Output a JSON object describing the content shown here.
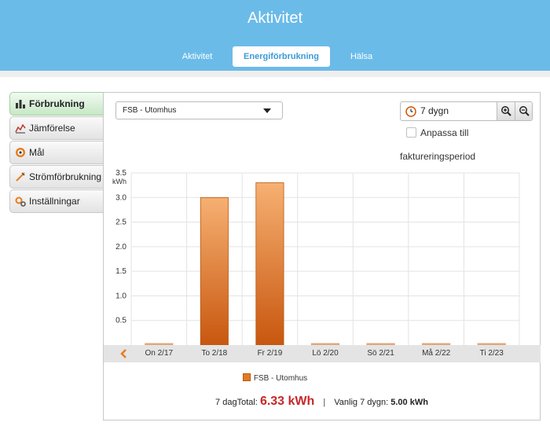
{
  "header": {
    "title": "Aktivitet",
    "tabs": [
      {
        "label": "Aktivitet",
        "active": false
      },
      {
        "label": "Energiförbrukning",
        "active": true
      },
      {
        "label": "Hälsa",
        "active": false
      }
    ]
  },
  "sidebar": {
    "items": [
      {
        "label": "Förbrukning",
        "icon": "bar-chart-icon",
        "active": true
      },
      {
        "label": "Jämförelse",
        "icon": "line-chart-icon",
        "active": false
      },
      {
        "label": "Mål",
        "icon": "target-icon",
        "active": false
      },
      {
        "label": "Strömförbrukning",
        "icon": "plug-icon",
        "active": false
      },
      {
        "label": "Inställningar",
        "icon": "gear-icon",
        "active": false
      }
    ]
  },
  "controls": {
    "location_select": "FSB - Utomhus",
    "period_label": "7 dygn",
    "zoom_in_icon": "zoom-in-icon",
    "zoom_out_icon": "zoom-out-icon",
    "checkbox_checked": false,
    "checkbox_label_line1": "Anpassa till",
    "checkbox_label_line2": "faktureringsperiod"
  },
  "chart_data": {
    "type": "bar",
    "categories": [
      "On 2/17",
      "To 2/18",
      "Fr 2/19",
      "Lö 2/20",
      "Sö 2/21",
      "Må 2/22",
      "Ti 2/23"
    ],
    "series": [
      {
        "name": "FSB - Utomhus",
        "values": [
          0,
          3.0,
          3.3,
          0,
          0,
          0,
          0
        ],
        "color": "#e37a22"
      }
    ],
    "ylabel": "kWh",
    "ylim": [
      0,
      3.5
    ],
    "yticks": [
      "0.5",
      "1.0",
      "1.5",
      "2.0",
      "2.5",
      "3.0",
      "3.5"
    ],
    "grid": true,
    "legend": "bottom"
  },
  "nav": {
    "prev_icon": "chevron-left-icon"
  },
  "totals": {
    "prefix": "7 dagTotal:",
    "total_value": "6.33 kWh",
    "separator": "|",
    "normal_prefix": "Vanlig 7 dygn:",
    "normal_value": "5.00 kWh"
  }
}
